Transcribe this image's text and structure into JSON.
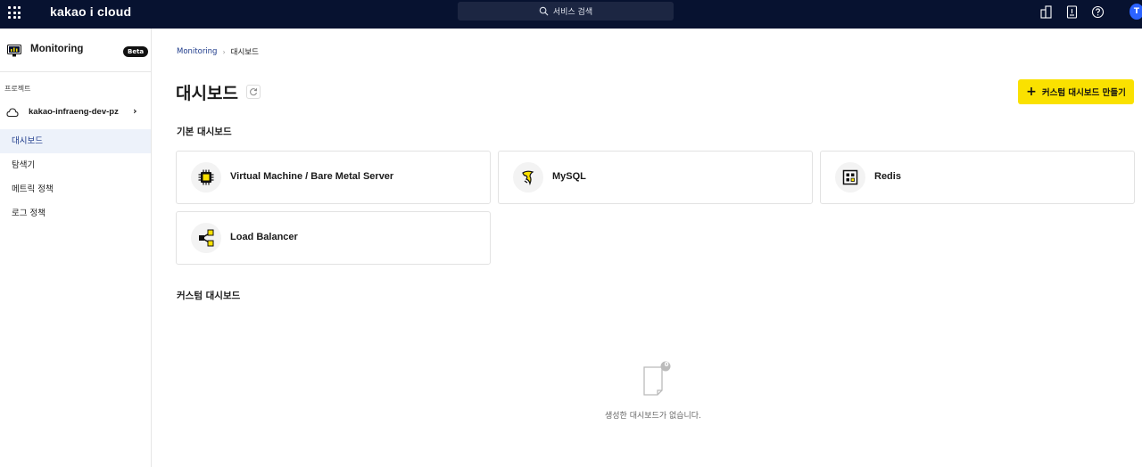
{
  "topbar": {
    "brand": "kakao i cloud",
    "search_placeholder": "서비스 검색",
    "avatar_initial": "T"
  },
  "sidebar": {
    "service_title": "Monitoring",
    "badge": "Beta",
    "project_label": "프로젝트",
    "project_name": "kakao-infraeng-dev-pz",
    "items": [
      {
        "label": "대시보드",
        "active": true
      },
      {
        "label": "탐색기",
        "active": false
      },
      {
        "label": "메트릭 정책",
        "active": false
      },
      {
        "label": "로그 정책",
        "active": false
      }
    ]
  },
  "breadcrumb": {
    "root": "Monitoring",
    "current": "대시보드"
  },
  "page": {
    "title": "대시보드",
    "create_button": "커스텀 대시보드 만들기",
    "basic_section": "기본 대시보드",
    "custom_section": "커스텀 대시보드",
    "cards": [
      {
        "label": "Virtual Machine / Bare Metal Server",
        "icon": "chip-icon"
      },
      {
        "label": "MySQL",
        "icon": "mysql-dolphin-icon"
      },
      {
        "label": "Redis",
        "icon": "redis-grid-icon"
      },
      {
        "label": "Load Balancer",
        "icon": "share-nodes-icon"
      }
    ],
    "empty_text": "생성한 대시보드가 없습니다.",
    "empty_badge": "0"
  },
  "colors": {
    "topbar": "#071230",
    "accent": "#fae100",
    "link": "#1d3a8a",
    "active_bg": "#edf2fa"
  }
}
